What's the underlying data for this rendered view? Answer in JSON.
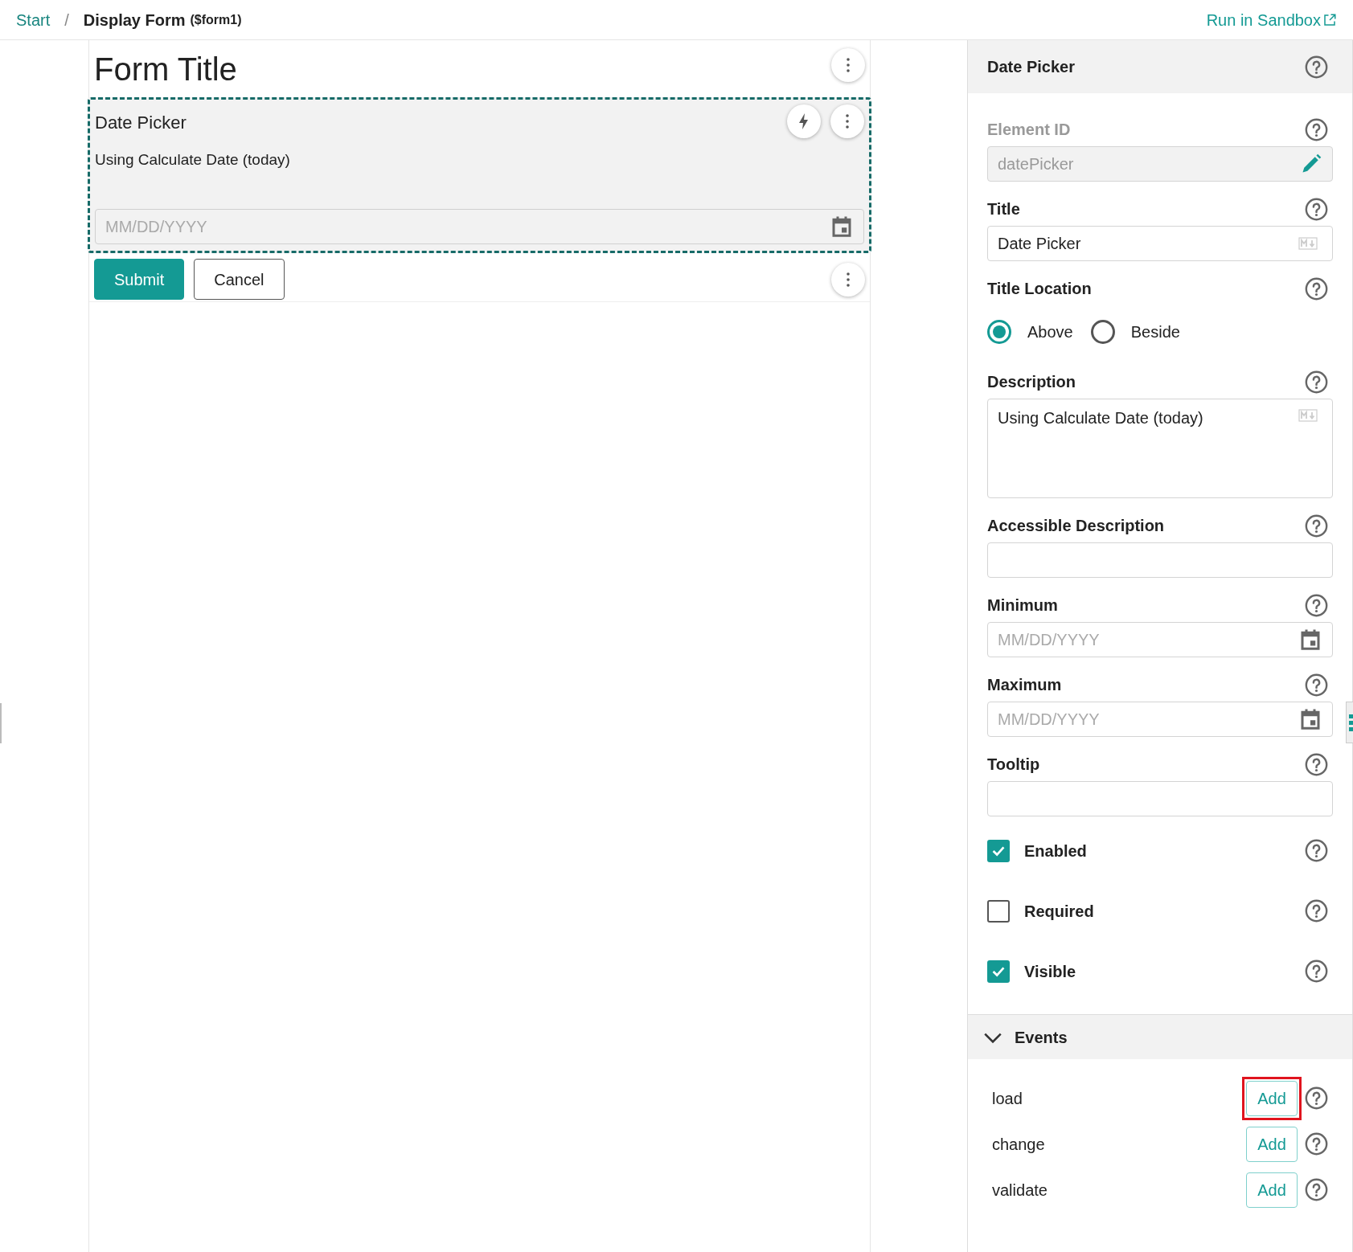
{
  "breadcrumb_separator": "/",
  "breadcrumb": [
    {
      "label": "Start",
      "kind": "link"
    },
    {
      "label": "Display Form",
      "suffix": "($form1)",
      "kind": "current"
    }
  ],
  "sandbox_link": "Run in Sandbox",
  "form": {
    "title": "Form Title",
    "element": {
      "title": "Date Picker",
      "description": "Using Calculate Date (today)",
      "placeholder": "MM/DD/YYYY",
      "selected": true
    },
    "buttons": [
      {
        "label": "Submit",
        "kind": "primary"
      },
      {
        "label": "Cancel",
        "kind": "secondary"
      }
    ]
  },
  "properties": {
    "title": "Date Picker",
    "fields": [
      {
        "kind": "text",
        "label": "Element ID",
        "value": "datePicker",
        "disabled": true
      },
      {
        "kind": "markdown",
        "label": "Title",
        "value": "Date Picker",
        "disabled": false
      },
      {
        "kind": "radio",
        "label": "Title Location",
        "options": [
          {
            "label": "Above",
            "selected": true
          },
          {
            "label": "Beside",
            "selected": false
          }
        ]
      },
      {
        "kind": "markdown_area",
        "label": "Description",
        "value": "Using Calculate Date (today)",
        "disabled": false
      },
      {
        "kind": "text",
        "label": "Accessible Description",
        "disabled": false
      },
      {
        "kind": "date",
        "label": "Minimum",
        "placeholder": "MM/DD/YYYY"
      },
      {
        "kind": "date",
        "label": "Maximum",
        "placeholder": "MM/DD/YYYY"
      },
      {
        "kind": "text",
        "label": "Tooltip",
        "disabled": false
      },
      {
        "kind": "checkbox",
        "label": "Enabled",
        "checked": true
      },
      {
        "kind": "checkbox",
        "label": "Required",
        "checked": false
      },
      {
        "kind": "checkbox",
        "label": "Visible",
        "checked": true
      }
    ]
  },
  "events": {
    "title": "Events",
    "expanded": true,
    "items": [
      {
        "name": "load",
        "button": "Add",
        "highlighted": true
      },
      {
        "name": "change",
        "button": "Add",
        "highlighted": false
      },
      {
        "name": "validate",
        "button": "Add",
        "highlighted": false
      }
    ]
  }
}
